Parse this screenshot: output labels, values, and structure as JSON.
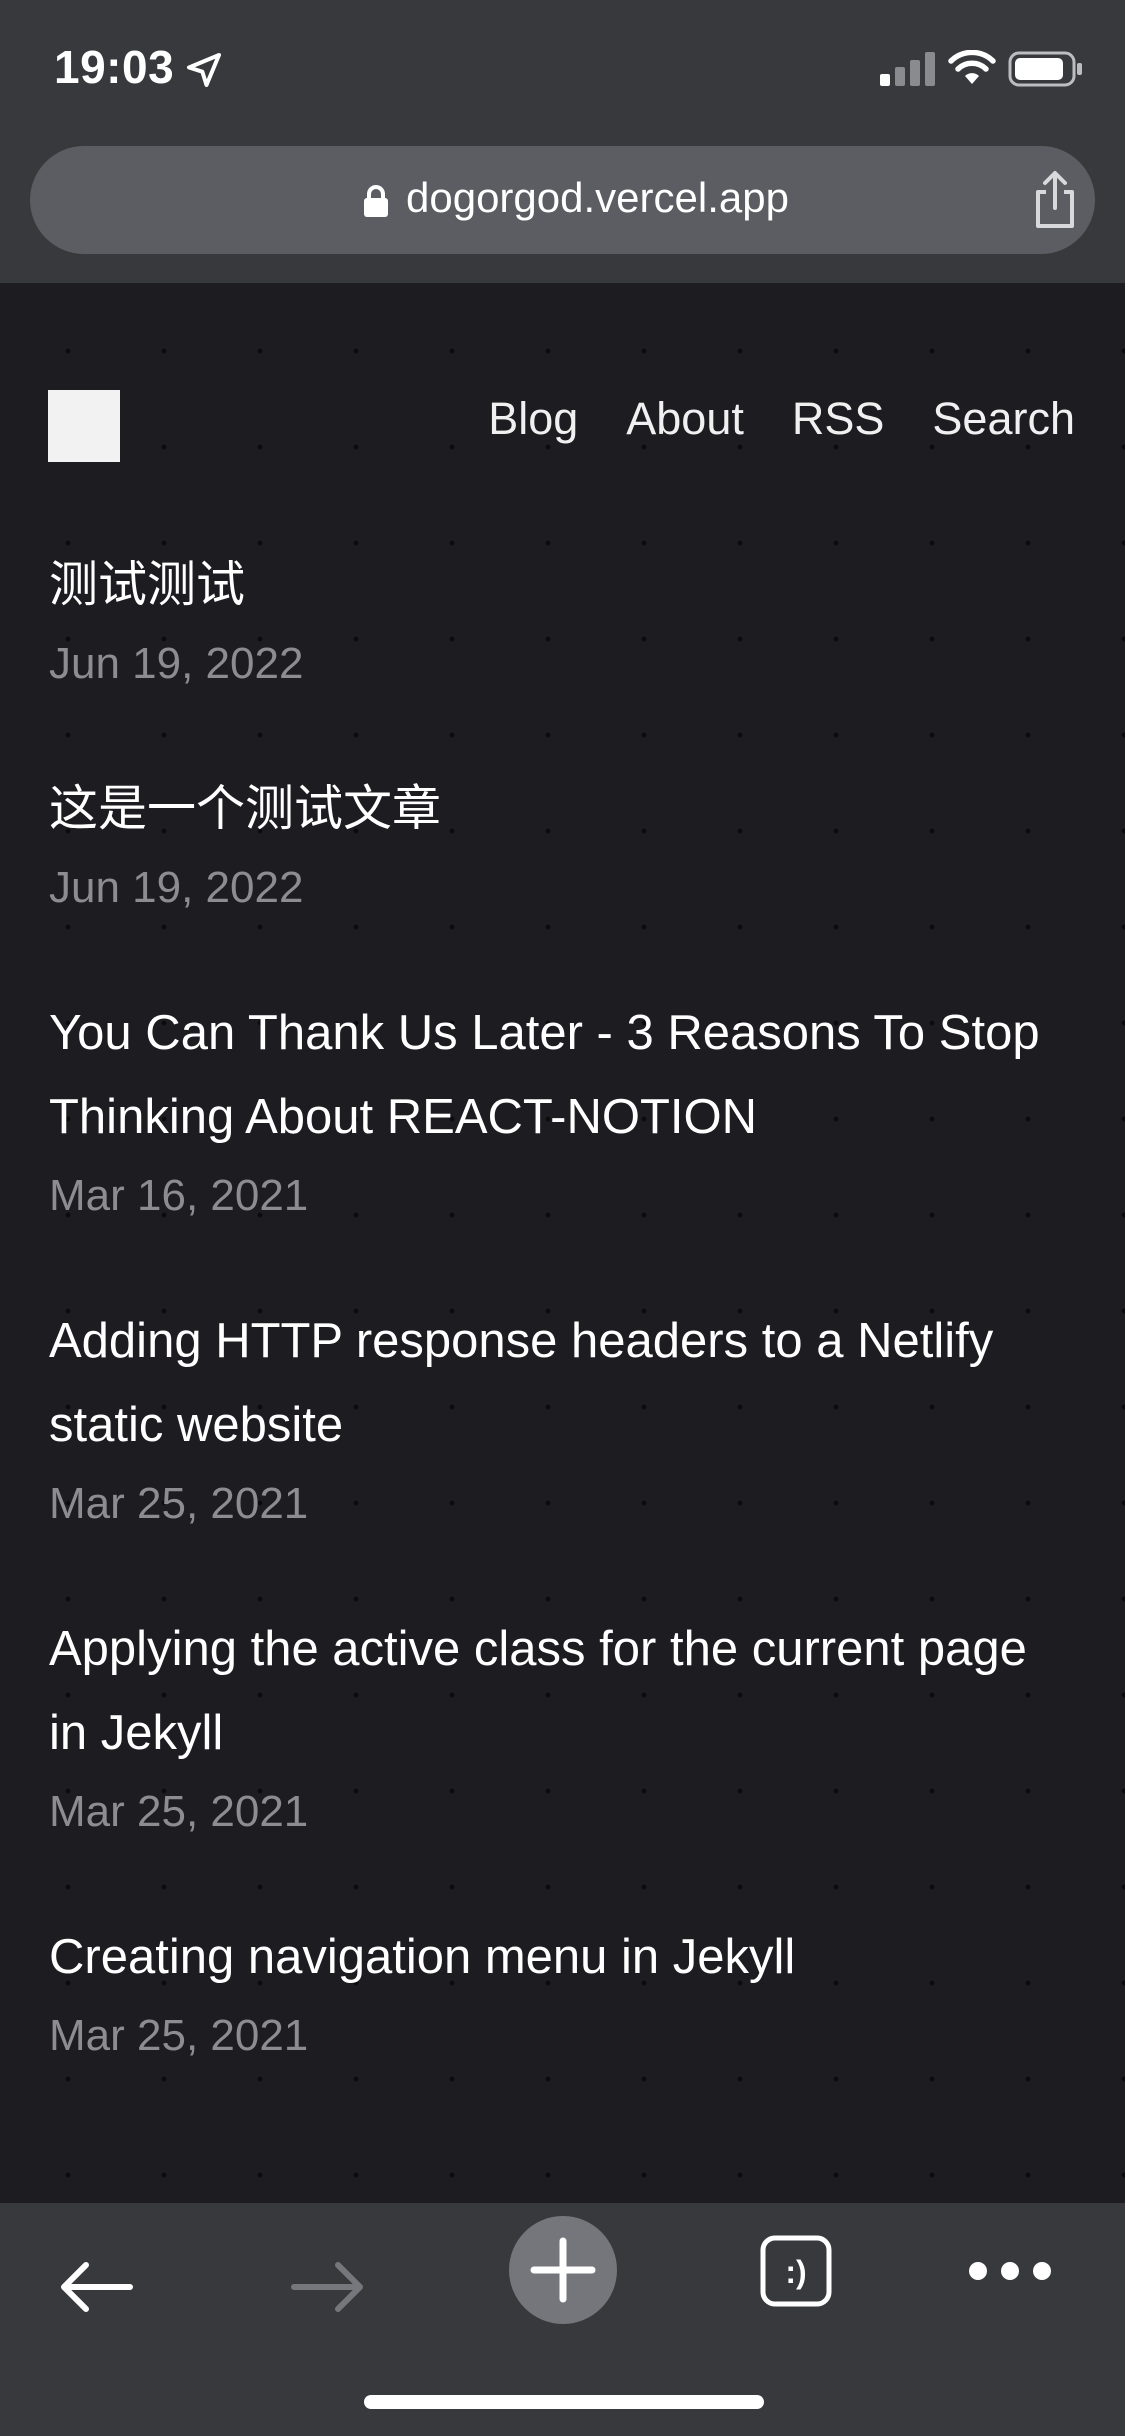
{
  "status_bar": {
    "time": "19:03"
  },
  "browser": {
    "url": "dogorgod.vercel.app",
    "tab_button_label": ":)"
  },
  "site": {
    "nav": [
      "Blog",
      "About",
      "RSS",
      "Search"
    ]
  },
  "posts": [
    {
      "title": "测试测试",
      "date": "Jun 19, 2022"
    },
    {
      "title": "这是一个测试文章",
      "date": "Jun 19, 2022"
    },
    {
      "title": "You Can Thank Us Later - 3 Reasons To Stop Thinking About REACT-NOTION",
      "date": "Mar 16, 2021"
    },
    {
      "title": "Adding HTTP response headers to a Netlify static website",
      "date": "Mar 25, 2021"
    },
    {
      "title": "Applying the active class for the current page in Jekyll",
      "date": "Mar 25, 2021"
    },
    {
      "title": "Creating navigation menu in Jekyll",
      "date": "Mar 25, 2021"
    }
  ],
  "colors": {
    "page_background": "#1c1c21",
    "browser_chrome": "#38393d",
    "date_text": "#8c8c92"
  }
}
